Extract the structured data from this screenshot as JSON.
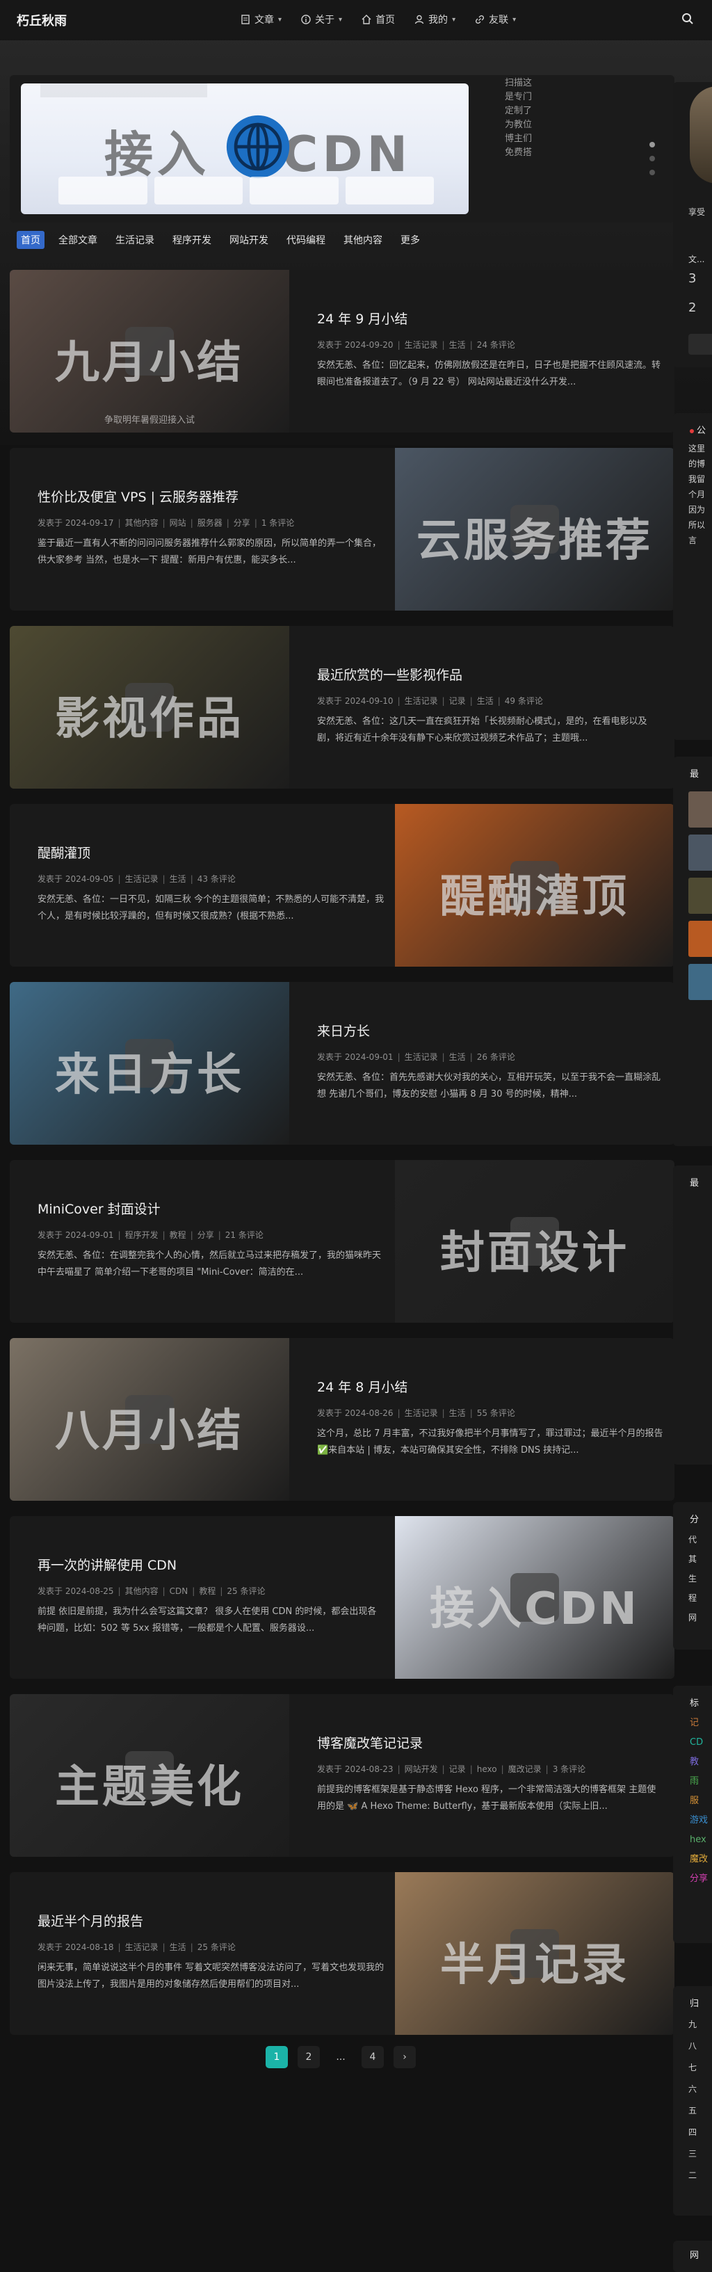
{
  "site": {
    "brand": "朽丘秋雨"
  },
  "nav": [
    {
      "label": "文章",
      "icon": "document-icon",
      "has_caret": true
    },
    {
      "label": "关于",
      "icon": "info-icon",
      "has_caret": true
    },
    {
      "label": "首页",
      "icon": "home-icon",
      "has_caret": false
    },
    {
      "label": "我的",
      "icon": "user-icon",
      "has_caret": true
    },
    {
      "label": "友联",
      "icon": "link-icon",
      "has_caret": true
    }
  ],
  "featured": {
    "cover_title": "接入",
    "cover_title_2": "CDN",
    "side_text": "扫描这是专门定制了为教位博主们免费搭"
  },
  "tabs": [
    "首页",
    "全部文章",
    "生活记录",
    "程序开发",
    "网站开发",
    "代码编程",
    "其他内容",
    "更多"
  ],
  "posts": [
    {
      "side": "left",
      "cover_title": "九月小结",
      "cover_caption": "争取明年暑假迎接入试",
      "cover_color": "#5a4b44",
      "title": "24 年 9 月小结",
      "meta": [
        "发表于 2024-09-20",
        "生活记录",
        "生活",
        "24 条评论"
      ],
      "excerpt": "安然无恙、各位：回忆起来，仿佛刚放假还是在昨日，日子也是把握不住顾风速流。转眼间也准备报道去了。（9 月 22 号） 网站网站最近没什么开发..."
    },
    {
      "side": "right",
      "cover_title": "云服务推荐",
      "cover_caption": "",
      "cover_color": "#4b5663",
      "title": "性价比及便宜 VPS | 云服务器推荐",
      "meta": [
        "发表于 2024-09-17",
        "其他内容",
        "网站",
        "服务器",
        "分享",
        "1 条评论"
      ],
      "excerpt": "鉴于最近一直有人不断的问问问服务器推荐什么郭家的原因，所以简单的弄一个集合，供大家参考 当然，也是水一下 提醒：新用户有优惠，能买多长..."
    },
    {
      "side": "left",
      "cover_title": "影视作品",
      "cover_caption": "",
      "cover_color": "#4e4a32",
      "title": "最近欣赏的一些影视作品",
      "meta": [
        "发表于 2024-09-10",
        "生活记录",
        "记录",
        "生活",
        "49 条评论"
      ],
      "excerpt": "安然无恙、各位：这几天一直在疯狂开始「长视频耐心模式」，是的，在看电影以及剧，将近有近十余年没有静下心来欣赏过视频艺术作品了；主题哦..."
    },
    {
      "side": "right",
      "cover_title": "醍醐灌顶",
      "cover_caption": "",
      "cover_color": "#b85a22",
      "title": "醍醐灌顶",
      "meta": [
        "发表于 2024-09-05",
        "生活记录",
        "生活",
        "43 条评论"
      ],
      "excerpt": "安然无恙、各位：一日不见，如隔三秋 今个的主题很简单；不熟悉的人可能不清楚，我个人，是有时候比较浮躁的，但有时候又很成熟？(根据不熟悉..."
    },
    {
      "side": "left",
      "cover_title": "来日方长",
      "cover_caption": "",
      "cover_color": "#3f6a86",
      "title": "来日方长",
      "meta": [
        "发表于 2024-09-01",
        "生活记录",
        "生活",
        "26 条评论"
      ],
      "excerpt": "安然无恙、各位：首先先感谢大伙对我的关心，互相开玩笑，以至于我不会一直糊涂乱想 先谢几个哥们，博友的安慰 小猫再 8 月 30 号的时候，精神..."
    },
    {
      "side": "right",
      "cover_title": "封面设计",
      "cover_caption": "",
      "cover_color": "#222222",
      "title": "MiniCover 封面设计",
      "meta": [
        "发表于 2024-09-01",
        "程序开发",
        "教程",
        "分享",
        "21 条评论"
      ],
      "excerpt": "安然无恙、各位：在调整完我个人的心情，然后就立马过来把存稿发了，我的猫咪昨天中午去喵星了 简单介绍一下老哥的项目 \"Mini-Cover：简洁的在..."
    },
    {
      "side": "left",
      "cover_title": "八月小结",
      "cover_caption": "",
      "cover_color": "#7b7164",
      "title": "24 年 8 月小结",
      "meta": [
        "发表于 2024-08-26",
        "生活记录",
        "生活",
        "55 条评论"
      ],
      "excerpt": "这个月，总比 7 月丰富，不过我好像把半个月事情写了，罪过罪过；最近半个月的报告 ✅来自本站 | 博友，本站可确保其安全性，不排除 DNS 挟持记..."
    },
    {
      "side": "right",
      "cover_title": "接入CDN",
      "cover_caption": "",
      "cover_color": "#dfe4ee",
      "title": "再一次的讲解使用 CDN",
      "meta": [
        "发表于 2024-08-25",
        "其他内容",
        "CDN",
        "教程",
        "25 条评论"
      ],
      "excerpt": "前提 依旧是前提，我为什么会写这篇文章？ 很多人在使用 CDN 的时候，都会出现各种问题，比如：502 等 5xx 报错等，一般都是个人配置、服务器设..."
    },
    {
      "side": "left",
      "cover_title": "主题美化",
      "cover_caption": "",
      "cover_color": "#2a2a2a",
      "title": "博客魔改笔记记录",
      "meta": [
        "发表于 2024-08-23",
        "网站开发",
        "记录",
        "hexo",
        "魔改记录",
        "3 条评论"
      ],
      "excerpt": "前提我的博客框架是基于静态博客 Hexo 程序，一个非常简洁强大的博客框架 主题使用的是 🦋 A Hexo Theme: Butterfly，基于最新版本使用（实际上旧..."
    },
    {
      "side": "right",
      "cover_title": "半月记录",
      "cover_caption": "",
      "cover_color": "#9a7a58",
      "title": "最近半个月的报告",
      "meta": [
        "发表于 2024-08-18",
        "生活记录",
        "生活",
        "25 条评论"
      ],
      "excerpt": "闲来无事，简单说说这半个月的事件 写着文呢突然博客没法访问了，写着文也发现我的图片没法上传了，我图片是用的对象储存然后使用帮们的项目对..."
    }
  ],
  "pagination": [
    "1",
    "2",
    "...",
    "4",
    "›"
  ],
  "sidebar": {
    "profile_name": "享受",
    "stat_label": "文...",
    "stat_values": [
      "3",
      "2"
    ],
    "announcement_title": "公",
    "announcement_lines": [
      "这里",
      "的博",
      "我留",
      "个月",
      "因为",
      "所以",
      "言"
    ],
    "latest_title": "最",
    "latest_comments_title": "最",
    "category_title": "分",
    "category_items": [
      "代",
      "其",
      "生",
      "程",
      "网"
    ],
    "tag_title": "标",
    "tags": [
      {
        "text": "记",
        "color": "#c97a3a"
      },
      {
        "text": "CD",
        "color": "#21b59c"
      },
      {
        "text": "教",
        "color": "#7b6ad9"
      },
      {
        "text": "雨",
        "color": "#4caf50"
      },
      {
        "text": "服",
        "color": "#d69236"
      },
      {
        "text": "游戏",
        "color": "#3a8fd0"
      },
      {
        "text": "hex",
        "color": "#59b06b"
      },
      {
        "text": "魔改",
        "color": "#e0a93a"
      },
      {
        "text": "分享",
        "color": "#d23fb0"
      }
    ],
    "archive_title": "归",
    "archive_items": [
      "九",
      "八",
      "七",
      "六",
      "五",
      "四",
      "三",
      "二"
    ],
    "site_title": "网"
  }
}
